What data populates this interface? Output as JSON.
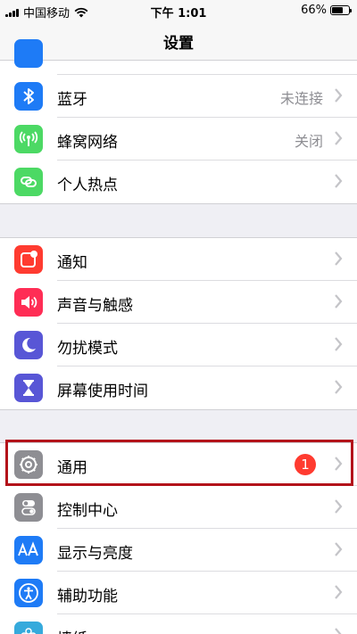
{
  "status_bar": {
    "carrier": "中国移动",
    "time": "下午 1:01",
    "battery": "66%",
    "battery_level": 0.66
  },
  "nav": {
    "title": "设置"
  },
  "groups": [
    [
      {
        "name": "bluetooth",
        "label": "蓝牙",
        "value": "未连接",
        "color": "#1e7bf6"
      },
      {
        "name": "cellular",
        "label": "蜂窝网络",
        "value": "关闭",
        "color": "#4cd964"
      },
      {
        "name": "hotspot",
        "label": "个人热点",
        "value": "",
        "color": "#4cd964"
      }
    ],
    [
      {
        "name": "notifications",
        "label": "通知",
        "value": "",
        "color": "#ff3b30"
      },
      {
        "name": "sounds",
        "label": "声音与触感",
        "value": "",
        "color": "#ff2d55"
      },
      {
        "name": "do-not-disturb",
        "label": "勿扰模式",
        "value": "",
        "color": "#5856d6"
      },
      {
        "name": "screen-time",
        "label": "屏幕使用时间",
        "value": "",
        "color": "#5856d6"
      }
    ],
    [
      {
        "name": "general",
        "label": "通用",
        "value": "",
        "badge": "1",
        "color": "#8e8e93"
      },
      {
        "name": "control-center",
        "label": "控制中心",
        "value": "",
        "color": "#8e8e93"
      },
      {
        "name": "display",
        "label": "显示与亮度",
        "value": "",
        "color": "#1e7bf6"
      },
      {
        "name": "accessibility",
        "label": "辅助功能",
        "value": "",
        "color": "#1e7bf6"
      },
      {
        "name": "wallpaper",
        "label": "墙纸",
        "value": "",
        "color": "#36aadc"
      }
    ]
  ]
}
